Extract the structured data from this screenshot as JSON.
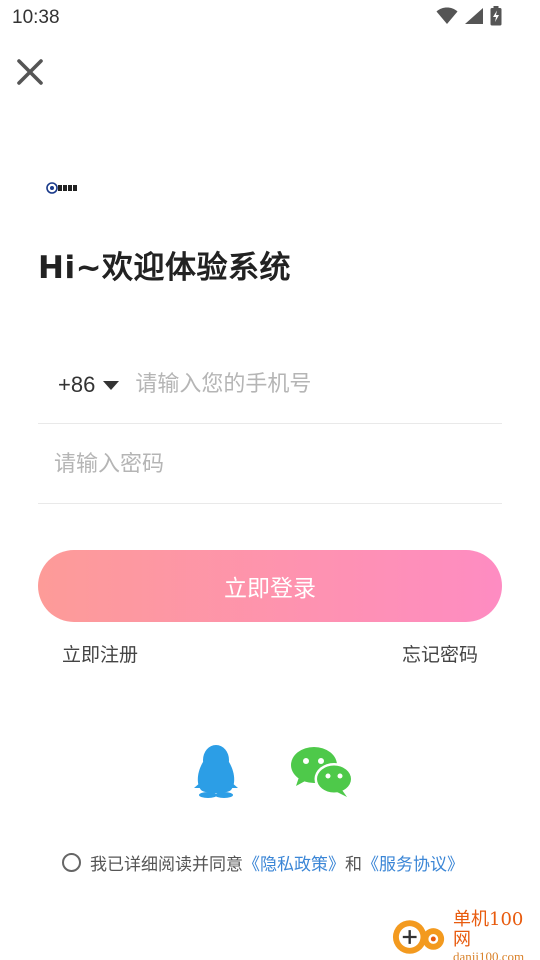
{
  "status_bar": {
    "time": "10:38",
    "icons": [
      "wifi-icon",
      "signal-icon",
      "battery-charging-icon"
    ]
  },
  "header": {
    "close_icon": "close-icon"
  },
  "welcome": {
    "title": "Hi~欢迎体验系统"
  },
  "form": {
    "country_code": "+86",
    "phone_placeholder": "请输入您的手机号",
    "password_placeholder": "请输入密码"
  },
  "actions": {
    "login_label": "立即登录",
    "register_label": "立即注册",
    "forgot_label": "忘记密码"
  },
  "social_login": {
    "icons": [
      "qq-icon",
      "wechat-icon"
    ]
  },
  "agreement": {
    "prefix": "我已详细阅读并同意",
    "privacy_link": "《隐私政策》",
    "and": "和",
    "service_link": "《服务协议》"
  },
  "watermark": {
    "title": "单机100网",
    "url": "danji100.com"
  },
  "colors": {
    "button_gradient_start": "#fd9b98",
    "button_gradient_end": "#fe8cc2",
    "link_blue": "#3b86d6",
    "qq_blue": "#2c9ee6",
    "wechat_green": "#4ec94a"
  }
}
